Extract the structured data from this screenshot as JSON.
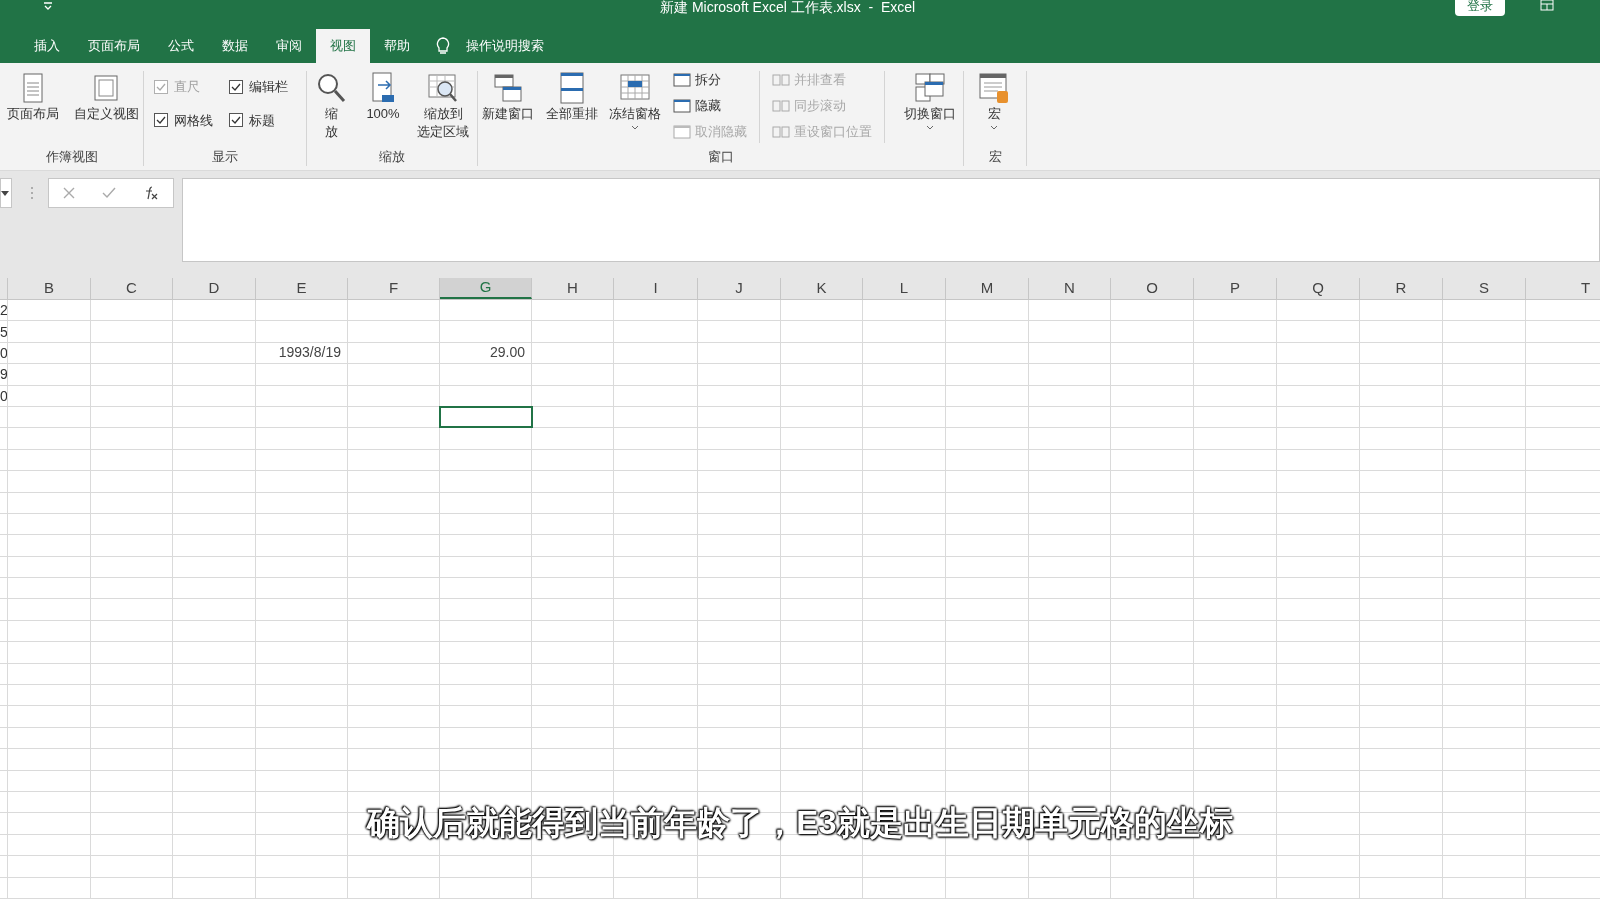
{
  "title_bar": {
    "title": "新建 Microsoft Excel 工作表.xlsx  -  Excel",
    "login": "登录"
  },
  "tabs": [
    {
      "label": "插入",
      "selected": false
    },
    {
      "label": "页面布局",
      "selected": false
    },
    {
      "label": "公式",
      "selected": false
    },
    {
      "label": "数据",
      "selected": false
    },
    {
      "label": "审阅",
      "selected": false
    },
    {
      "label": "视图",
      "selected": true
    },
    {
      "label": "帮助",
      "selected": false
    }
  ],
  "tell_me": "操作说明搜索",
  "ribbon": {
    "workbook_views": {
      "label": "作簿视图",
      "buttons": [
        "页面布局",
        "自定义视图"
      ]
    },
    "show": {
      "label": "显示",
      "options": [
        {
          "label": "直尺",
          "checked": true,
          "disabled": true
        },
        {
          "label": "编辑栏",
          "checked": true,
          "disabled": false
        },
        {
          "label": "网格线",
          "checked": true,
          "disabled": false
        },
        {
          "label": "标题",
          "checked": true,
          "disabled": false
        }
      ]
    },
    "zoom": {
      "label": "缩放",
      "buttons": [
        {
          "lines": [
            "缩",
            "放"
          ]
        },
        {
          "lines": [
            "100%"
          ]
        },
        {
          "lines": [
            "缩放到",
            "选定区域"
          ]
        }
      ]
    },
    "window": {
      "label": "窗口",
      "buttons": [
        {
          "label": "新建窗口",
          "dropdown": false
        },
        {
          "label": "全部重排",
          "dropdown": false
        },
        {
          "label": "冻结窗格",
          "dropdown": true
        }
      ],
      "small": [
        {
          "label": "拆分",
          "disabled": false
        },
        {
          "label": "隐藏",
          "disabled": false
        },
        {
          "label": "取消隐藏",
          "disabled": true
        }
      ],
      "side": [
        {
          "label": "并排查看",
          "disabled": true
        },
        {
          "label": "同步滚动",
          "disabled": true
        },
        {
          "label": "重设窗口位置",
          "disabled": true
        }
      ],
      "switch": {
        "label": "切换窗口",
        "dropdown": true
      }
    },
    "macros": {
      "label": "宏",
      "button": {
        "label": "宏",
        "dropdown": true
      }
    }
  },
  "sheet": {
    "columns": [
      {
        "label": "B",
        "selected": false
      },
      {
        "label": "C",
        "selected": false
      },
      {
        "label": "D",
        "selected": false
      },
      {
        "label": "E",
        "selected": false
      },
      {
        "label": "F",
        "selected": false
      },
      {
        "label": "G",
        "selected": true
      },
      {
        "label": "H",
        "selected": false
      },
      {
        "label": "I",
        "selected": false
      },
      {
        "label": "J",
        "selected": false
      },
      {
        "label": "K",
        "selected": false
      },
      {
        "label": "L",
        "selected": false
      },
      {
        "label": "M",
        "selected": false
      },
      {
        "label": "N",
        "selected": false
      },
      {
        "label": "O",
        "selected": false
      },
      {
        "label": "P",
        "selected": false
      },
      {
        "label": "Q",
        "selected": false
      },
      {
        "label": "R",
        "selected": false
      },
      {
        "label": "S",
        "selected": false
      },
      {
        "label": "T",
        "selected": false
      }
    ],
    "rows": [
      {
        "cut": "2",
        "selected": false
      },
      {
        "cut": "5",
        "selected": false
      },
      {
        "cut": "0",
        "E": "1993/8/19",
        "G": "29.00",
        "selected": false
      },
      {
        "cut": "9",
        "selected": false
      },
      {
        "cut": "0",
        "selected": false
      },
      {
        "selected": true
      }
    ]
  },
  "caption": "确认后就能得到当前年龄了，E3就是出生日期单元格的坐标"
}
